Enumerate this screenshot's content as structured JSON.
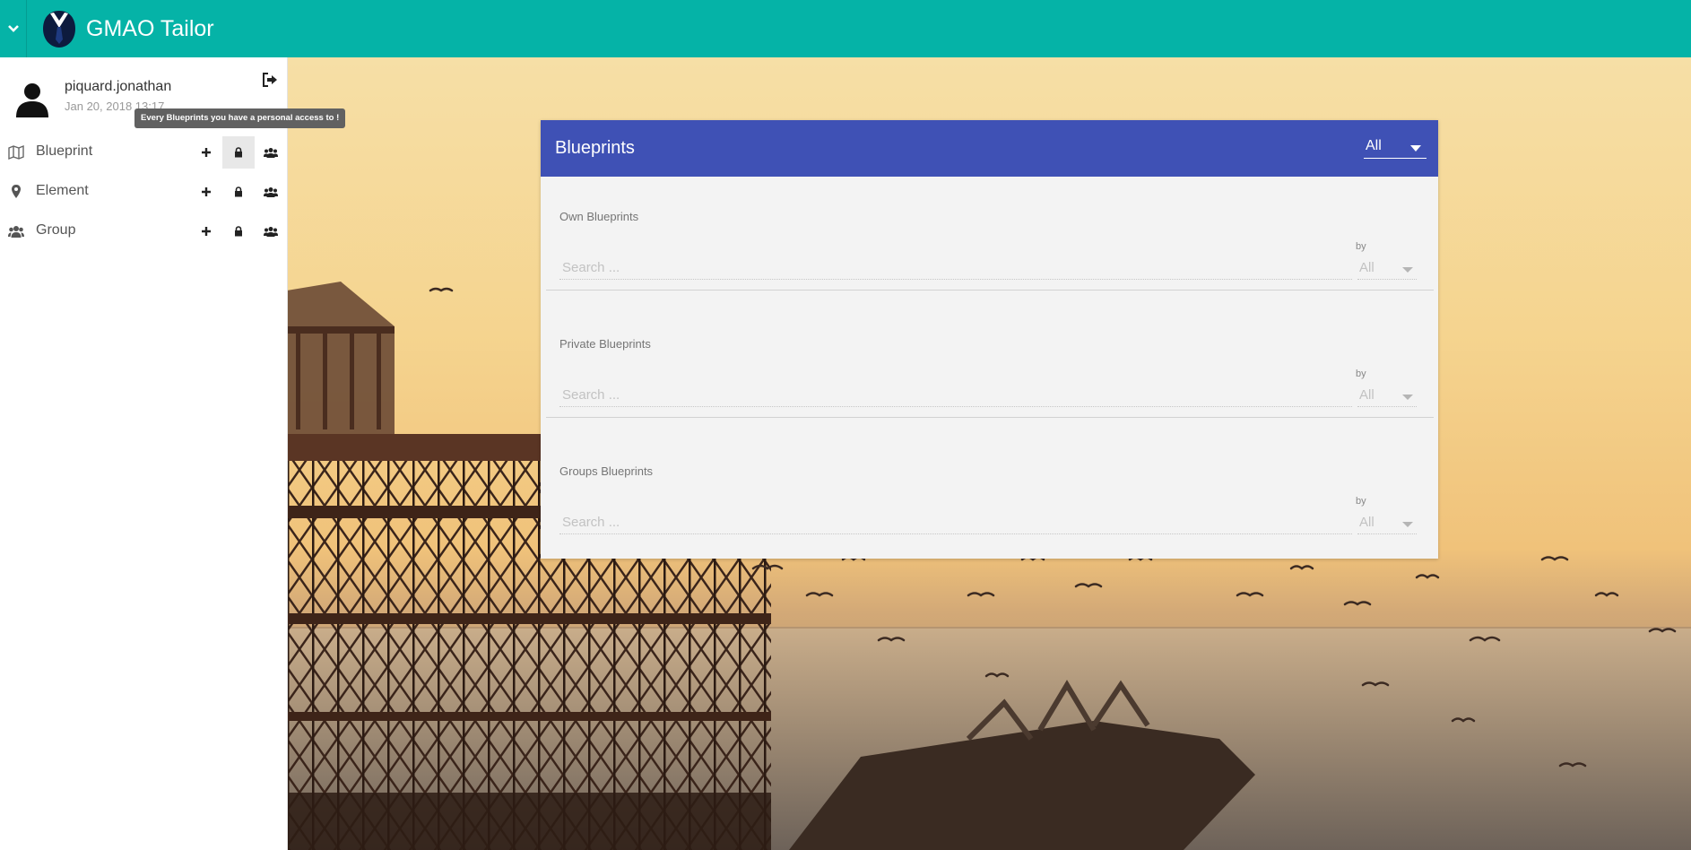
{
  "app": {
    "title": "GMAO Tailor"
  },
  "user": {
    "name": "piquard.jonathan",
    "last_login": "Jan 20, 2018 13:17"
  },
  "tooltip": {
    "text": "Every Blueprints you have a personal access to !"
  },
  "sidebar": {
    "items": [
      {
        "label": "Blueprint",
        "icon": "map-icon",
        "active_action": "lock"
      },
      {
        "label": "Element",
        "icon": "map-marker-icon",
        "active_action": ""
      },
      {
        "label": "Group",
        "icon": "users-icon",
        "active_action": ""
      }
    ],
    "actions": [
      "plus-icon",
      "lock-icon",
      "users-icon"
    ]
  },
  "panel": {
    "title": "Blueprints",
    "filter": "All",
    "sections": [
      {
        "title": "Own Blueprints",
        "search_placeholder": "Search ...",
        "by_label": "by",
        "by_value": "All"
      },
      {
        "title": "Private Blueprints",
        "search_placeholder": "Search ...",
        "by_label": "by",
        "by_value": "All"
      },
      {
        "title": "Groups Blueprints",
        "search_placeholder": "Search ...",
        "by_label": "by",
        "by_value": "All"
      }
    ]
  },
  "colors": {
    "topbar": "#05b3a7",
    "panel_header": "#3f51b5",
    "panel_body": "#f3f3f3",
    "tooltip": "#616161"
  }
}
